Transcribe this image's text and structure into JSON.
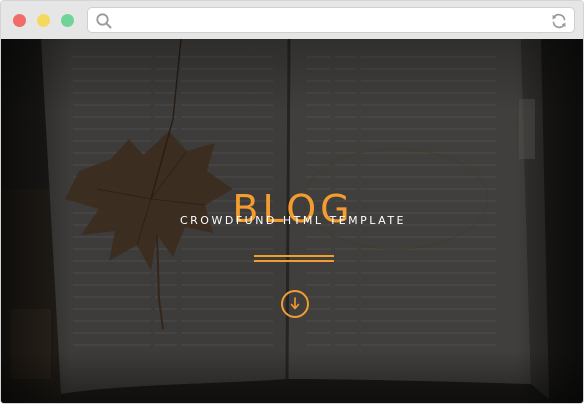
{
  "browser": {
    "address": {
      "value": "",
      "placeholder": ""
    },
    "window_controls": {
      "close_color": "#f26b6b",
      "minimize_color": "#f3d95e",
      "maximize_color": "#6fd49a"
    },
    "search_icon": "search-icon",
    "refresh_icon": "refresh-icon"
  },
  "hero": {
    "title": "BLOG",
    "subtitle": "CROWDFUND HTML TEMPLATE",
    "scroll_icon": "arrow-down-icon",
    "background": "open-book-with-autumn-leaf-photo"
  },
  "colors": {
    "accent": "#f39c2f",
    "overlay": "#1f1f1f",
    "text": "#ffffff"
  }
}
